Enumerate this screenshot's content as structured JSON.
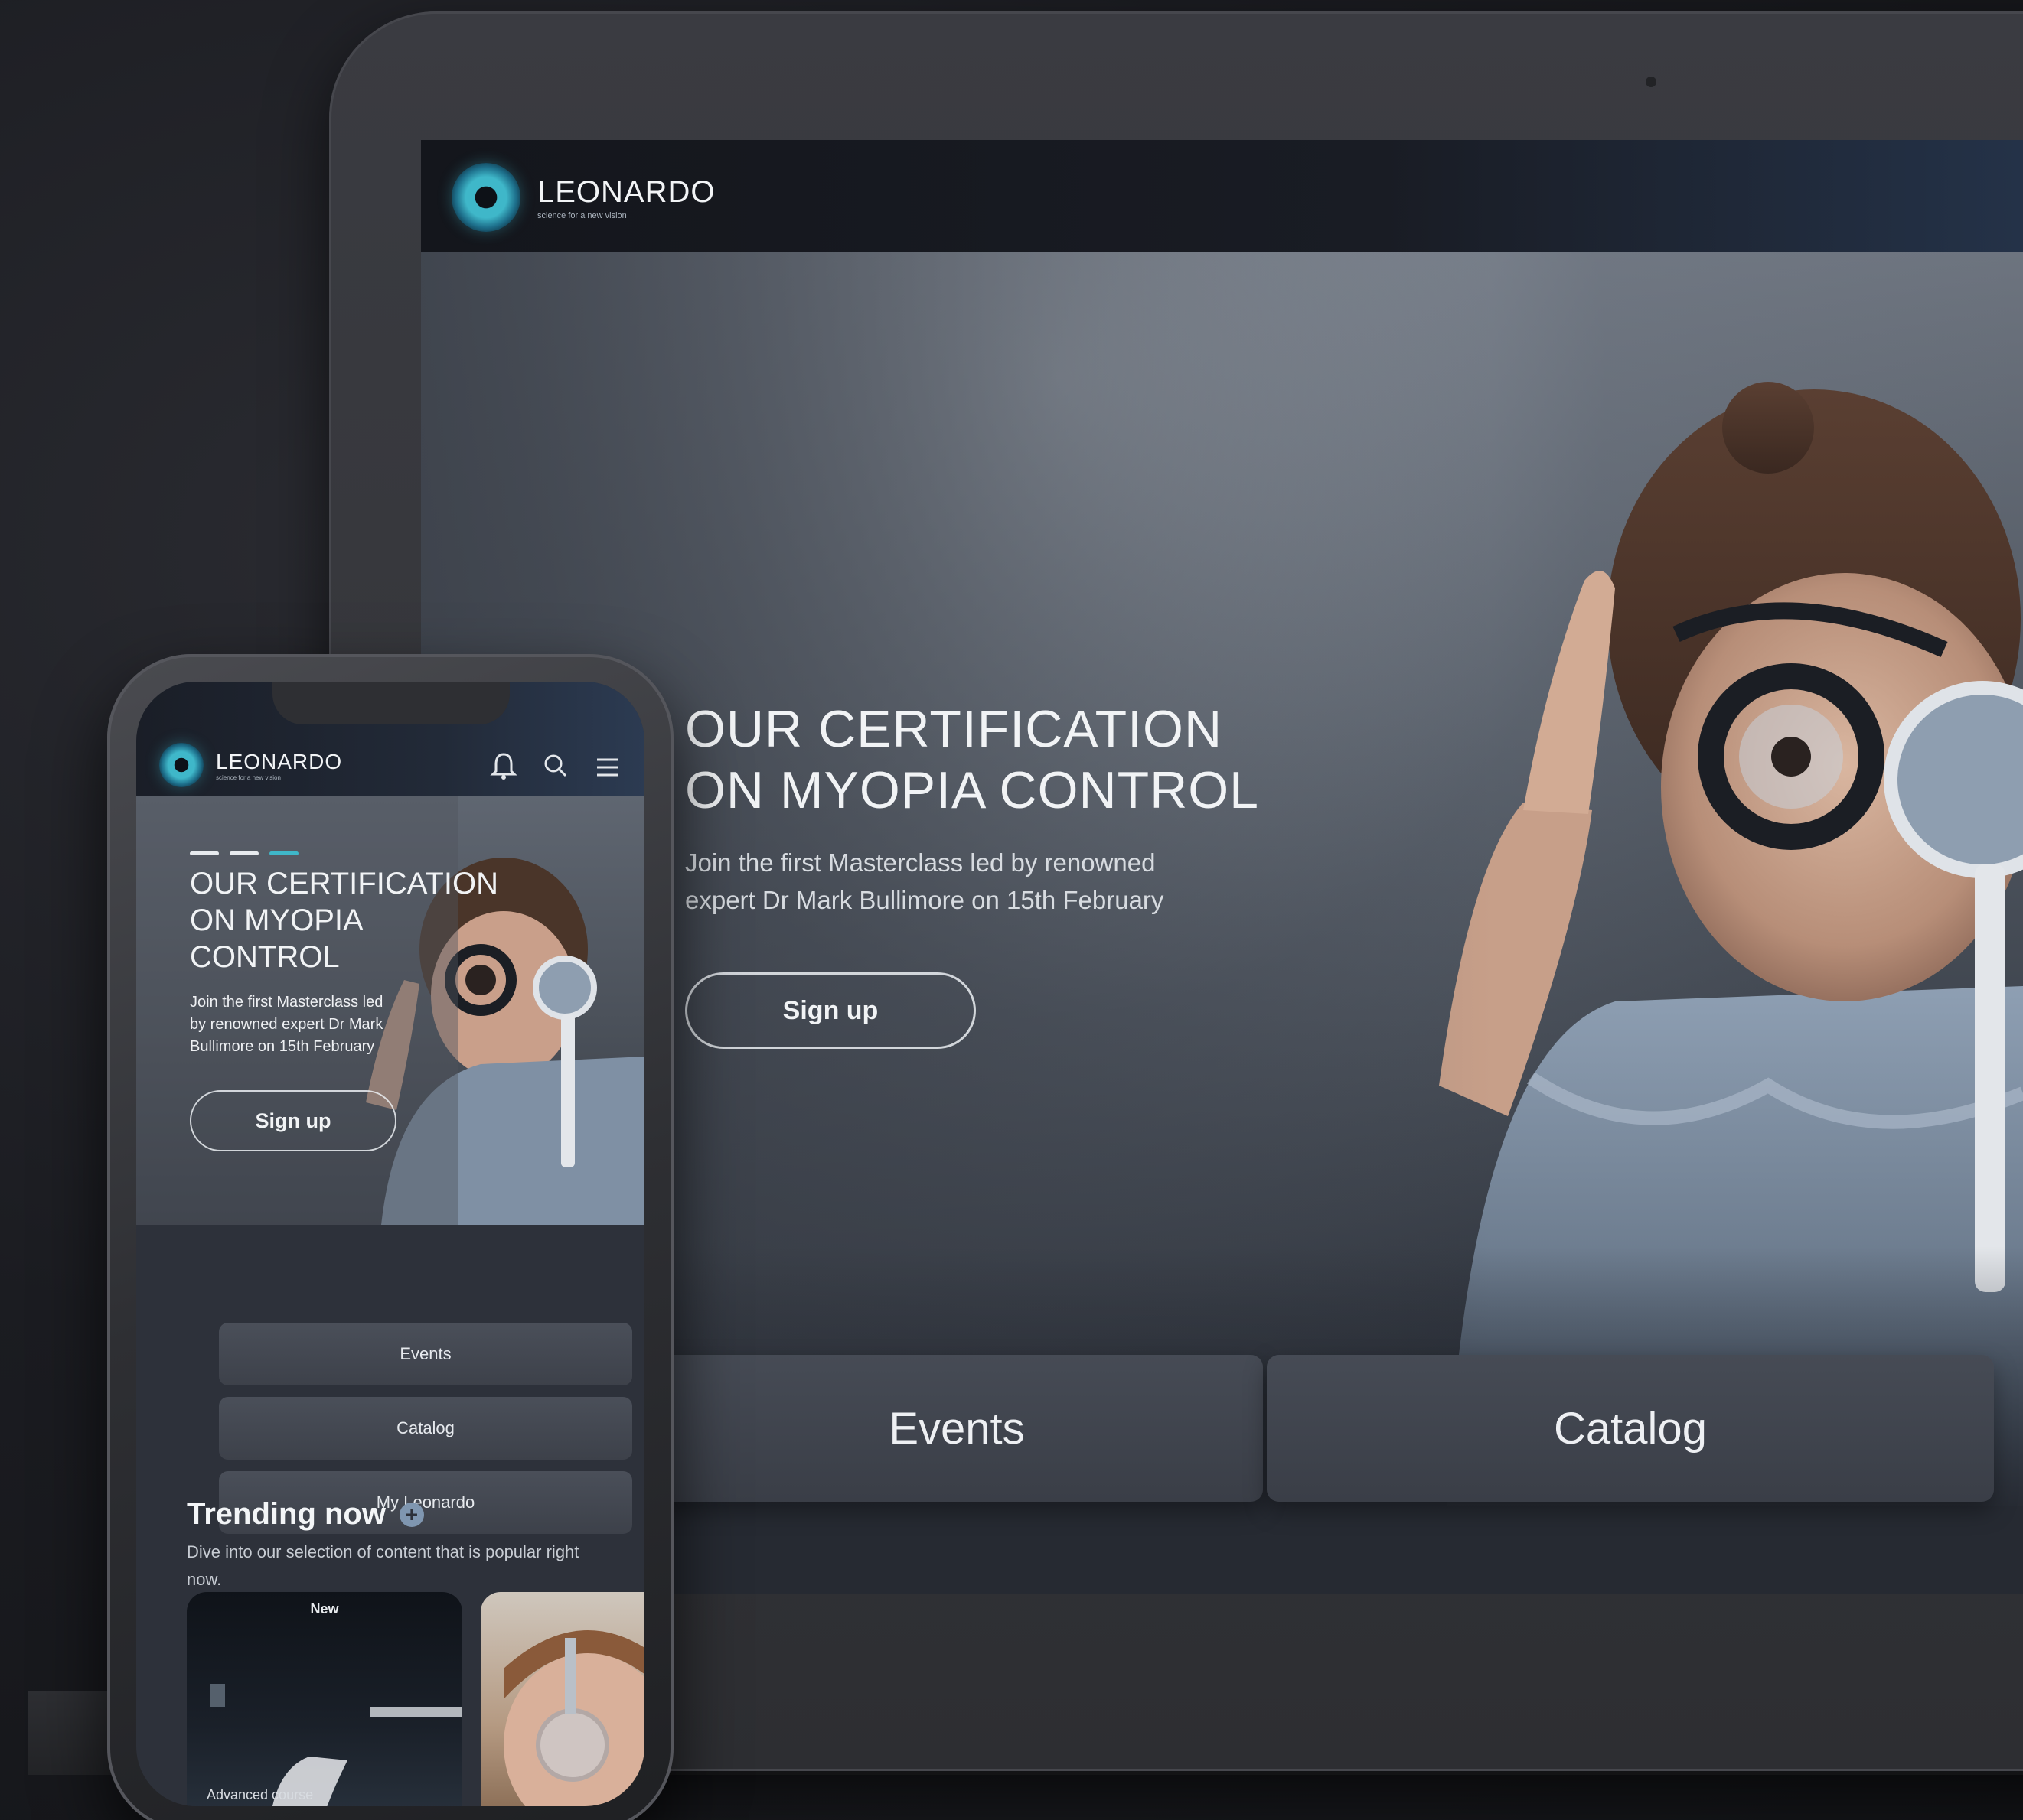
{
  "brand": {
    "name": "LEONARDO",
    "tagline": "science for a new vision",
    "accent_color": "#3fb7c9"
  },
  "desktop": {
    "hero": {
      "title_line1": "OUR CERTIFICATION",
      "title_line2": "ON MYOPIA CONTROL",
      "subtitle_line1": "Join the first Masterclass led by renowned",
      "subtitle_line2": "expert Dr Mark Bullimore on 15th February",
      "cta_label": "Sign up"
    },
    "tiles": [
      {
        "label": "Events"
      },
      {
        "label": "Catalog"
      }
    ]
  },
  "mobile": {
    "header_icons": [
      "bell-icon",
      "search-icon",
      "menu-icon"
    ],
    "hero": {
      "title_line1": "OUR CERTIFICATION",
      "title_line2": "ON MYOPIA",
      "title_line3": "CONTROL",
      "subtitle_line1": "Join the first Masterclass led",
      "subtitle_line2": "by renowned expert Dr Mark",
      "subtitle_line3": "Bullimore on 15th February",
      "cta_label": "Sign up",
      "carousel_slides": 3,
      "carousel_active": 3
    },
    "nav_tiles": [
      {
        "label": "Events"
      },
      {
        "label": "Catalog"
      },
      {
        "label": "My Leonardo"
      }
    ],
    "trending": {
      "title": "Trending now",
      "subtitle_line1": "Dive into our selection of content that is popular right",
      "subtitle_line2": "now.",
      "cards": [
        {
          "badge": "New",
          "caption": "Advanced course"
        },
        {
          "badge": "",
          "caption": ""
        }
      ]
    }
  }
}
